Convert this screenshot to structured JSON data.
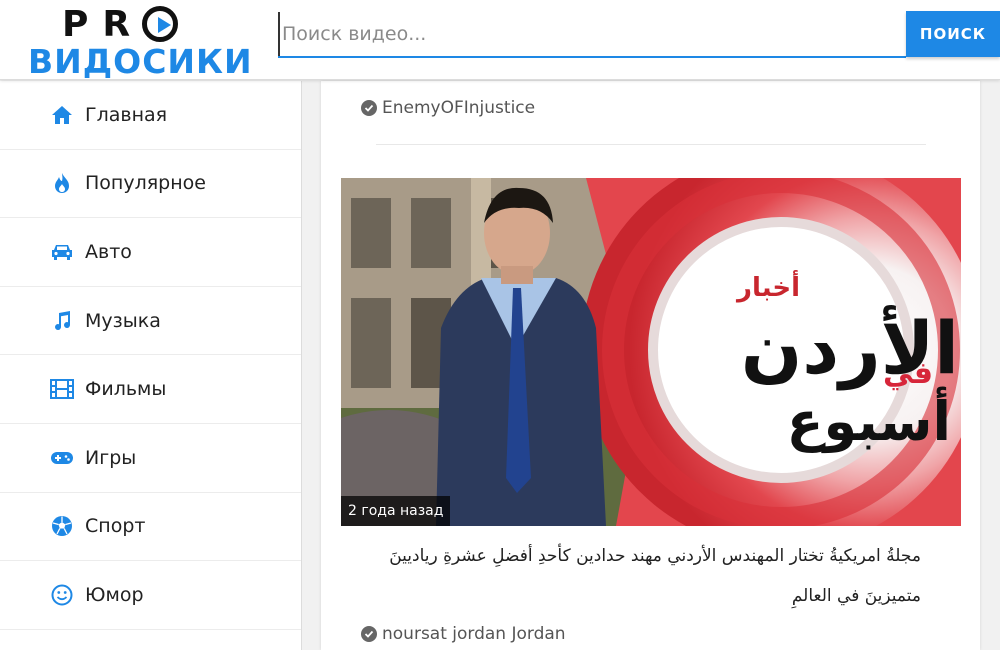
{
  "header": {
    "logo_top": "PR",
    "logo_bottom": "ВИДОСИКИ",
    "search_placeholder": "Поиск видео...",
    "search_button": "ПОИСК",
    "accent_color": "#1e88e5"
  },
  "sidebar": {
    "items": [
      {
        "label": "Главная",
        "icon": "home-icon"
      },
      {
        "label": "Популярное",
        "icon": "flame-icon"
      },
      {
        "label": "Авто",
        "icon": "car-icon"
      },
      {
        "label": "Музыка",
        "icon": "music-note-icon"
      },
      {
        "label": "Фильмы",
        "icon": "film-icon"
      },
      {
        "label": "Игры",
        "icon": "gamepad-icon"
      },
      {
        "label": "Спорт",
        "icon": "soccer-ball-icon"
      },
      {
        "label": "Юмор",
        "icon": "smiley-icon"
      }
    ]
  },
  "feed": {
    "prev_author": "EnemyOFInjustice",
    "video": {
      "age": "2 года назад",
      "thumb_text_top": "أخبار",
      "thumb_text_main": "الأردن",
      "thumb_text_mid": "في",
      "thumb_text_bottom": "أسبوع",
      "title_line1": "مجلةُ امريكيةُ تختار المهندس الأردني مهند حدادين كأحدِ أفضلِ عشرةِ رياديينَ",
      "title_line2": "متميزينَ في العالمِ",
      "author": "noursat jordan Jordan"
    }
  }
}
